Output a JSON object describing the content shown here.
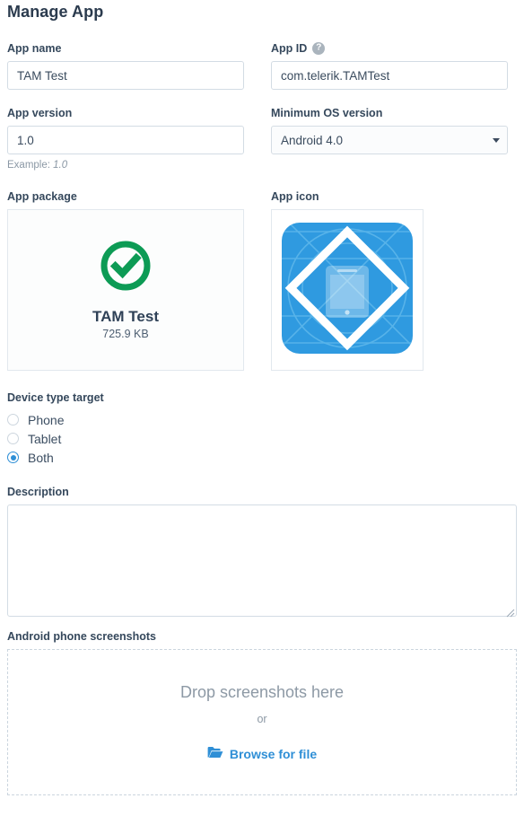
{
  "page": {
    "title": "Manage App"
  },
  "fields": {
    "app_name": {
      "label": "App name",
      "value": "TAM Test",
      "placeholder": ""
    },
    "app_id": {
      "label": "App ID",
      "value": "com.telerik.TAMTest",
      "placeholder": "",
      "help_icon": "help-circle-icon",
      "help_glyph": "?"
    },
    "app_version": {
      "label": "App version",
      "value": "1.0",
      "placeholder": "",
      "hint_prefix": "Example:",
      "hint_value": "1.0"
    },
    "minimum_os_version": {
      "label": "Minimum OS version",
      "value": "Android 4.0",
      "options": [
        "Android 4.0"
      ]
    },
    "app_package": {
      "label": "App package",
      "status_icon": "check-circle-icon",
      "name": "TAM Test",
      "size": "725.9 KB"
    },
    "app_icon": {
      "label": "App icon",
      "icon_name": "app-icon-preview"
    },
    "device_type_target": {
      "label": "Device type target",
      "options": [
        {
          "label": "Phone",
          "selected": false
        },
        {
          "label": "Tablet",
          "selected": false
        },
        {
          "label": "Both",
          "selected": true
        }
      ]
    },
    "description": {
      "label": "Description",
      "value": "",
      "placeholder": ""
    },
    "android_phone_screenshots": {
      "label": "Android phone screenshots",
      "drop_text": "Drop screenshots here",
      "or_text": "or",
      "browse_text": "Browse for file",
      "browse_icon": "folder-open-icon"
    }
  },
  "colors": {
    "accent_blue": "#2f8fd6",
    "success_green": "#0d9b55",
    "text_dark": "#35485c",
    "text_muted": "#8d99a5",
    "border": "#d3dce4",
    "app_icon_blue": "#2f9ae0"
  }
}
